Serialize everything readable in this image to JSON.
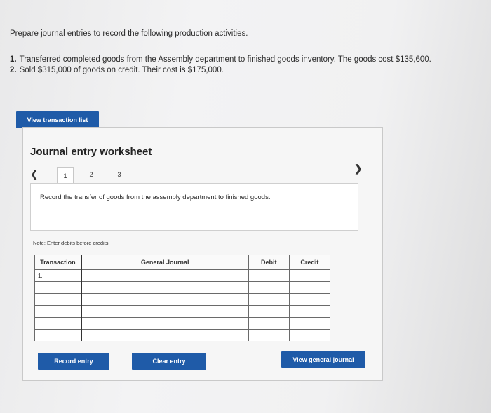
{
  "intro": "Prepare journal entries to record the following production activities.",
  "items": [
    {
      "num": "1.",
      "text": "Transferred completed goods from the Assembly department to finished goods inventory. The goods cost $135,600."
    },
    {
      "num": "2.",
      "text": "Sold $315,000 of goods on credit. Their cost is $175,000."
    }
  ],
  "buttons": {
    "view_transactions": "View transaction list",
    "record_entry": "Record entry",
    "clear_entry": "Clear entry",
    "view_general_journal": "View general journal"
  },
  "worksheet": {
    "title": "Journal entry worksheet",
    "tabs": [
      "1",
      "2",
      "3"
    ],
    "instruction": "Record the transfer of goods from the assembly department to finished goods.",
    "note": "Note: Enter debits before credits."
  },
  "table": {
    "headers": {
      "transaction": "Transaction",
      "general_journal": "General Journal",
      "debit": "Debit",
      "credit": "Credit"
    },
    "first_row_label": "1."
  },
  "icons": {
    "prev": "chevron-left-icon",
    "next": "chevron-right-icon"
  },
  "colors": {
    "button": "#1f5ba8"
  }
}
